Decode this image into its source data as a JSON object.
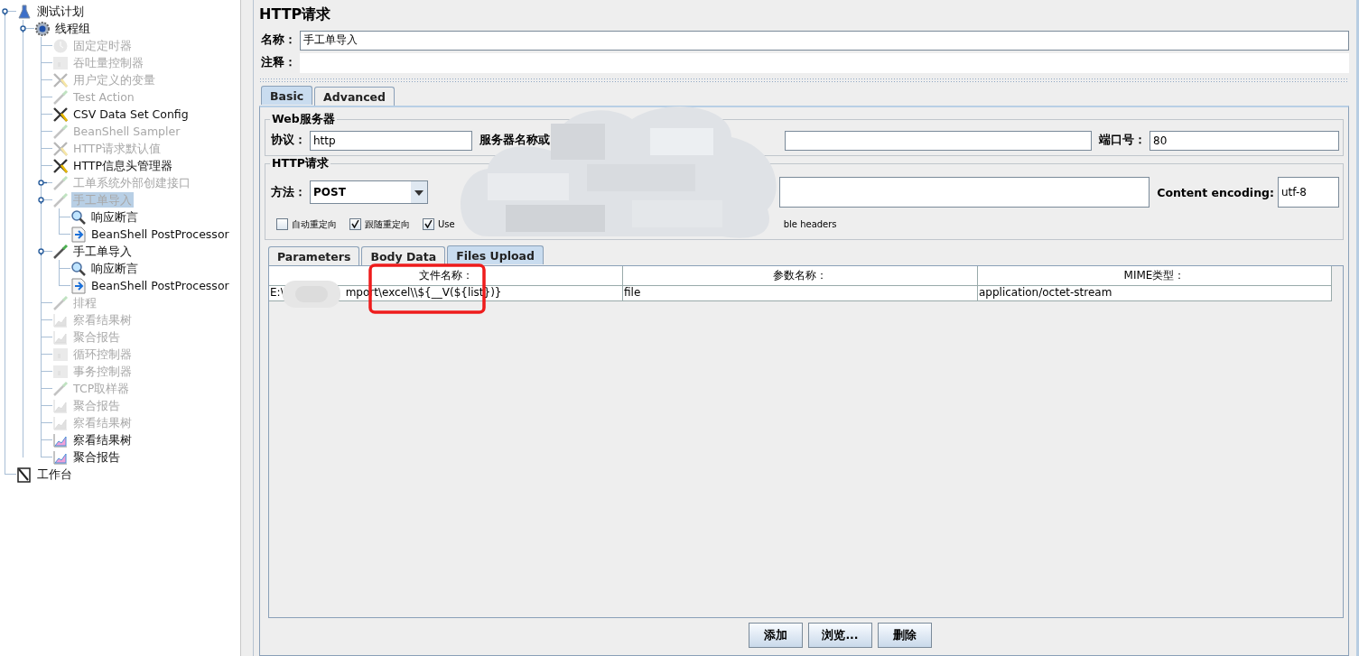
{
  "tree": [
    {
      "label": "测试计划",
      "kind": "plan",
      "disabled": false,
      "selected": false,
      "expanded": true,
      "children": [
        {
          "label": "线程组",
          "kind": "threadgroup",
          "disabled": false,
          "selected": false,
          "expanded": true,
          "children": [
            {
              "label": "固定定时器",
              "kind": "timer",
              "disabled": true,
              "selected": false
            },
            {
              "label": "吞吐量控制器",
              "kind": "controller",
              "disabled": true,
              "selected": false
            },
            {
              "label": "用户定义的变量",
              "kind": "config",
              "disabled": true,
              "selected": false
            },
            {
              "label": "Test Action",
              "kind": "sampler",
              "disabled": true,
              "selected": false
            },
            {
              "label": "CSV Data Set Config",
              "kind": "config",
              "disabled": false,
              "selected": false
            },
            {
              "label": "BeanShell Sampler",
              "kind": "sampler",
              "disabled": true,
              "selected": false
            },
            {
              "label": "HTTP请求默认值",
              "kind": "config",
              "disabled": true,
              "selected": false
            },
            {
              "label": "HTTP信息头管理器",
              "kind": "config",
              "disabled": false,
              "selected": false
            },
            {
              "label": "工单系统外部创建接口",
              "kind": "sampler",
              "disabled": true,
              "selected": false,
              "expanded": false
            },
            {
              "label": "手工单导入",
              "kind": "sampler",
              "disabled": true,
              "selected": true,
              "expanded": true,
              "children": [
                {
                  "label": "响应断言",
                  "kind": "assertion",
                  "disabled": false,
                  "selected": false
                },
                {
                  "label": "BeanShell PostProcessor",
                  "kind": "postprocessor",
                  "disabled": false,
                  "selected": false
                }
              ]
            },
            {
              "label": "手工单导入",
              "kind": "sampler",
              "disabled": false,
              "selected": false,
              "expanded": true,
              "children": [
                {
                  "label": "响应断言",
                  "kind": "assertion",
                  "disabled": false,
                  "selected": false
                },
                {
                  "label": "BeanShell PostProcessor",
                  "kind": "postprocessor",
                  "disabled": false,
                  "selected": false
                }
              ]
            },
            {
              "label": "排程",
              "kind": "sampler",
              "disabled": true,
              "selected": false
            },
            {
              "label": "察看结果树",
              "kind": "listener",
              "disabled": true,
              "selected": false
            },
            {
              "label": "聚合报告",
              "kind": "listener",
              "disabled": true,
              "selected": false
            },
            {
              "label": "循环控制器",
              "kind": "controller",
              "disabled": true,
              "selected": false
            },
            {
              "label": "事务控制器",
              "kind": "controller",
              "disabled": true,
              "selected": false
            },
            {
              "label": "TCP取样器",
              "kind": "sampler",
              "disabled": true,
              "selected": false
            },
            {
              "label": "聚合报告",
              "kind": "listener",
              "disabled": true,
              "selected": false
            },
            {
              "label": "察看结果树",
              "kind": "listener",
              "disabled": true,
              "selected": false
            },
            {
              "label": "察看结果树",
              "kind": "listener",
              "disabled": false,
              "selected": false
            },
            {
              "label": "聚合报告",
              "kind": "listener",
              "disabled": false,
              "selected": false
            }
          ]
        }
      ]
    },
    {
      "label": "工作台",
      "kind": "workbench",
      "disabled": false,
      "selected": false
    }
  ],
  "editor": {
    "title": "HTTP请求",
    "name_label": "名称：",
    "name_value": "手工单导入",
    "comment_label": "注释：",
    "tabs": [
      {
        "label": "Basic",
        "selected": true
      },
      {
        "label": "Advanced",
        "selected": false
      }
    ],
    "web_server": {
      "legend": "Web服务器",
      "protocol_label": "协议：",
      "protocol_value": "http",
      "server_label": "服务器名称或",
      "port_label": "端口号：",
      "port_value": "80"
    },
    "http_request": {
      "legend": "HTTP请求",
      "method_label": "方法：",
      "method_value": "POST",
      "encoding_label": "Content encoding:",
      "encoding_value": "utf-8",
      "options": [
        {
          "label": "自动重定向",
          "checked": false
        },
        {
          "label": "跟随重定向",
          "checked": true
        },
        {
          "label": "Use",
          "checked": true
        }
      ],
      "options_tail": "ble headers"
    },
    "sub_tabs": [
      {
        "label": "Parameters",
        "selected": false
      },
      {
        "label": "Body Data",
        "selected": false
      },
      {
        "label": "Files Upload",
        "selected": true
      }
    ],
    "files_table": {
      "columns": [
        "文件名称：",
        "参数名称：",
        "MIME类型："
      ],
      "rows": [
        {
          "path_start": "E:\\",
          "path_end": "mport\\excel\\\\${__V(${list})}",
          "parameter": "file",
          "mime": "application/octet-stream"
        }
      ]
    },
    "buttons": [
      "添加",
      "浏览...",
      "删除"
    ]
  }
}
